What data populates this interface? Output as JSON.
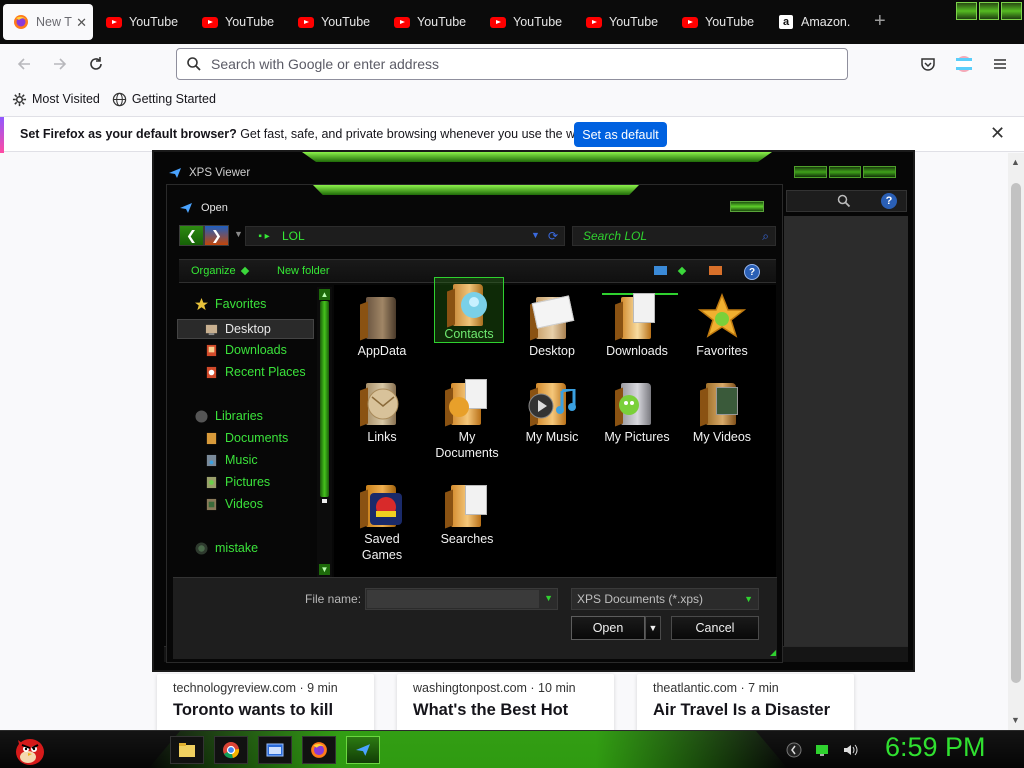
{
  "browser": {
    "tabs": [
      {
        "title": "New T",
        "kind": "firefox",
        "active": true
      },
      {
        "title": "YouTube",
        "kind": "youtube"
      },
      {
        "title": "YouTube",
        "kind": "youtube"
      },
      {
        "title": "YouTube",
        "kind": "youtube"
      },
      {
        "title": "YouTube",
        "kind": "youtube"
      },
      {
        "title": "YouTube",
        "kind": "youtube"
      },
      {
        "title": "YouTube",
        "kind": "youtube"
      },
      {
        "title": "YouTube",
        "kind": "youtube"
      },
      {
        "title": "Amazon.",
        "kind": "amazon"
      }
    ],
    "new_tab_glyph": "+",
    "url_placeholder": "Search with Google or enter address",
    "bookmarks": [
      {
        "label": "Most Visited",
        "icon": "gear-icon"
      },
      {
        "label": "Getting Started",
        "icon": "globe-icon"
      }
    ],
    "notification": {
      "bold": "Set Firefox as your default browser?",
      "text": " Get fast, safe, and private browsing whenever you use the web.",
      "button": "Set as default"
    }
  },
  "stories": [
    {
      "source": "technologyreview.com · 9 min",
      "title": "Toronto wants to kill"
    },
    {
      "source": "washingtonpost.com · 10 min",
      "title": "What's the Best Hot"
    },
    {
      "source": "theatlantic.com · 7 min",
      "title": "Air Travel Is a Disaster"
    }
  ],
  "xps_window": {
    "title": "XPS Viewer",
    "help": "?"
  },
  "dialog": {
    "title": "Open",
    "path": "LOL",
    "search_placeholder": "Search LOL",
    "organize": "Organize",
    "new_folder": "New folder",
    "help": "?",
    "nav": {
      "favorites": "Favorites",
      "favorites_items": [
        "Desktop",
        "Downloads",
        "Recent Places"
      ],
      "libraries": "Libraries",
      "libraries_items": [
        "Documents",
        "Music",
        "Pictures",
        "Videos"
      ],
      "user": "mistake"
    },
    "files": [
      {
        "label": "AppData",
        "icon": "folder-icon"
      },
      {
        "label": "Contacts",
        "icon": "contacts-folder-icon",
        "selected": true
      },
      {
        "label": "Desktop",
        "icon": "desktop-folder-icon"
      },
      {
        "label": "Downloads",
        "icon": "downloads-folder-icon"
      },
      {
        "label": "Favorites",
        "icon": "favorites-star-icon"
      },
      {
        "label": "Links",
        "icon": "links-folder-icon"
      },
      {
        "label": "My Documents",
        "icon": "documents-folder-icon"
      },
      {
        "label": "My Music",
        "icon": "music-folder-icon"
      },
      {
        "label": "My Pictures",
        "icon": "pictures-folder-icon"
      },
      {
        "label": "My Videos",
        "icon": "videos-folder-icon"
      },
      {
        "label": "Saved Games",
        "icon": "angry-birds-space-icon"
      },
      {
        "label": "Searches",
        "icon": "searches-folder-icon"
      }
    ],
    "file_name_label": "File name:",
    "file_name_value": "",
    "filter": "XPS Documents (*.xps)",
    "open_button": "Open",
    "cancel_button": "Cancel"
  },
  "taskbar": {
    "apps": [
      "explorer-icon",
      "chrome-icon",
      "window-icon",
      "firefox-icon",
      "xps-viewer-icon"
    ],
    "clock": "6:59 PM"
  }
}
